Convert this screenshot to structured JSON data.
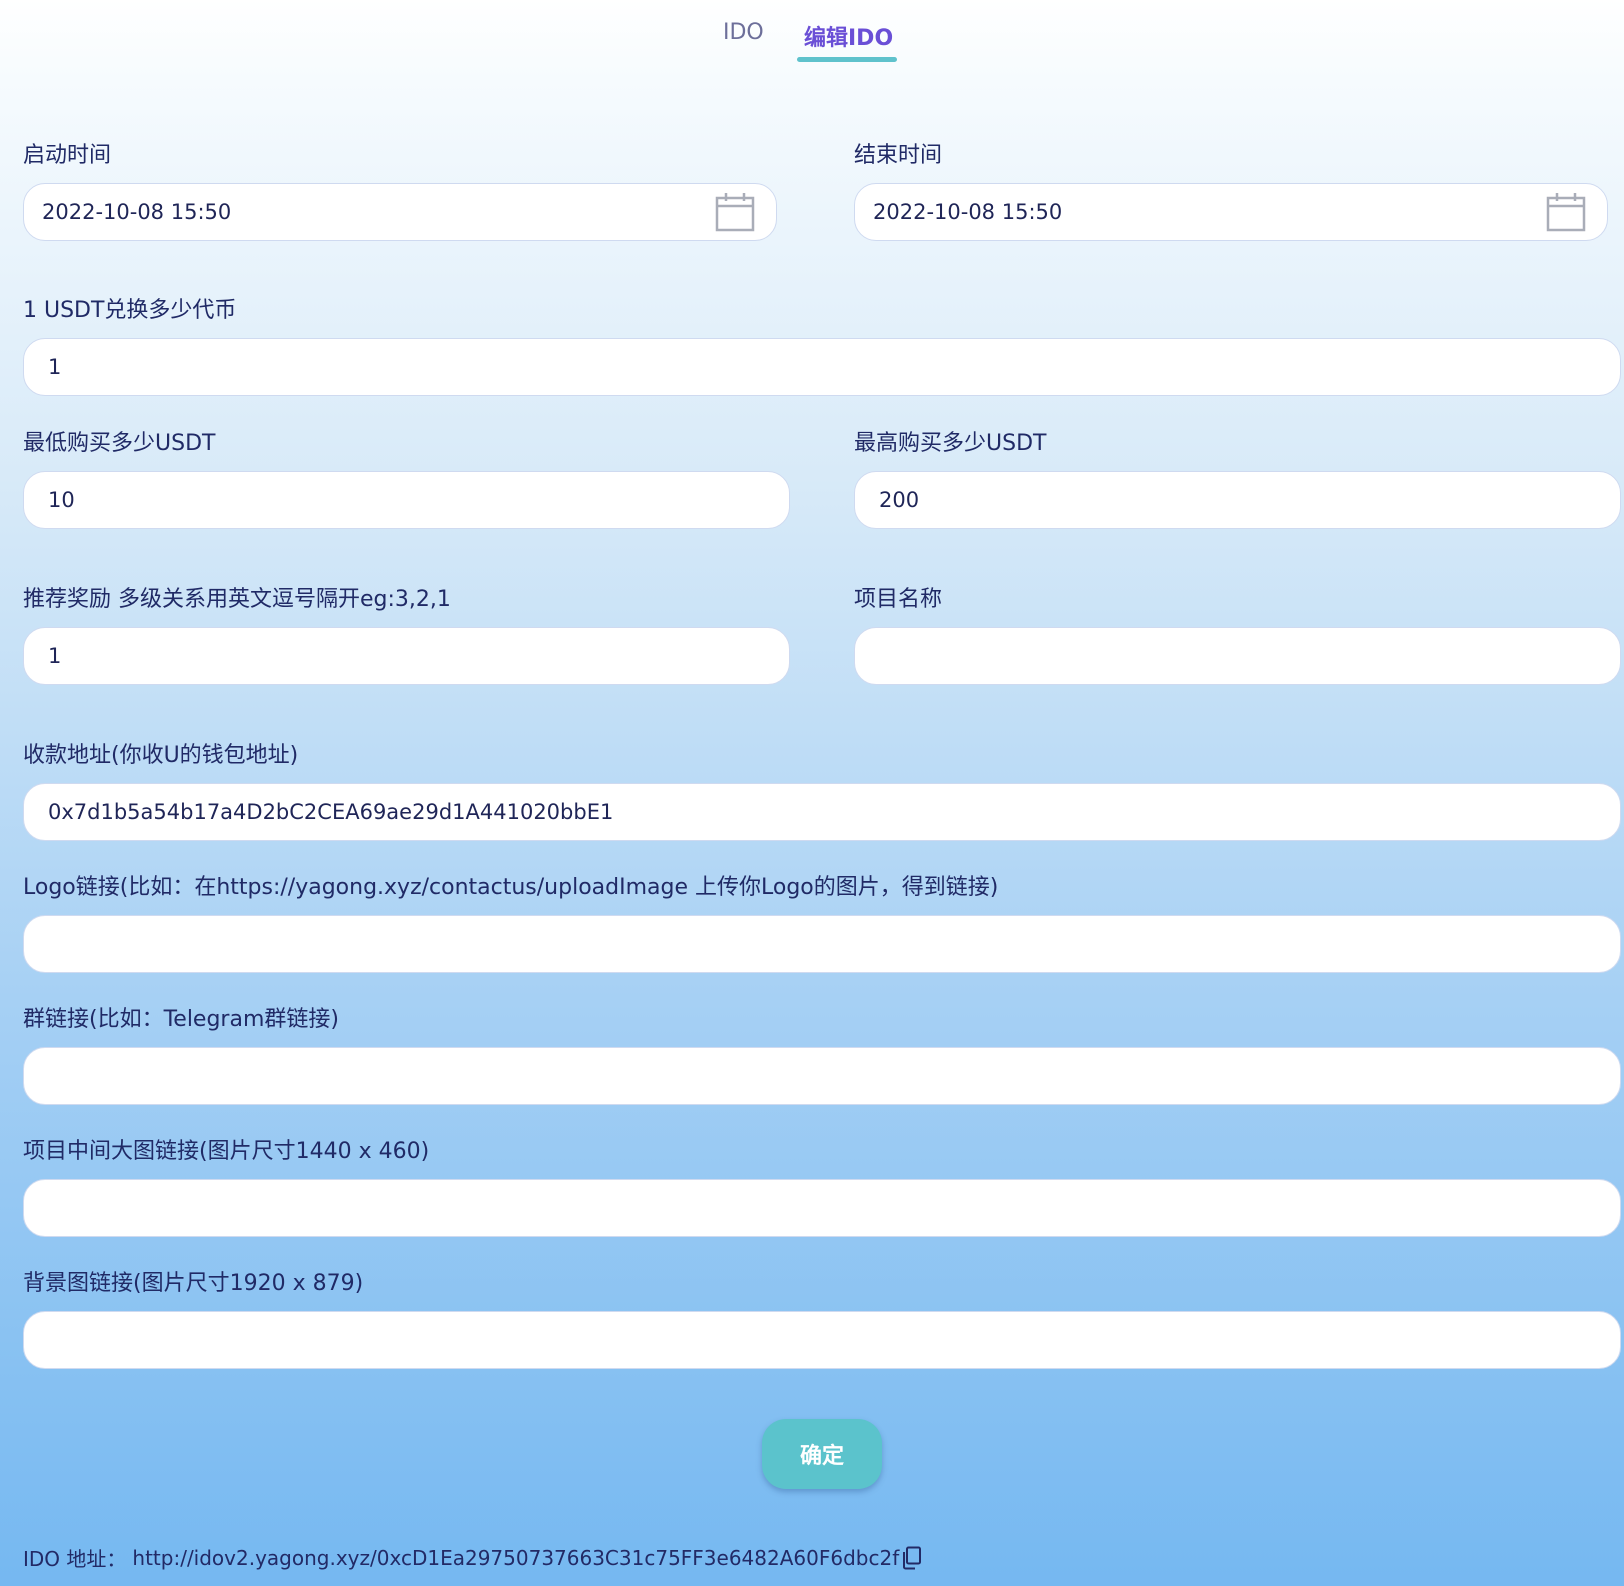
{
  "tabs": {
    "items": [
      {
        "label": "IDO"
      },
      {
        "label": "编辑IDO"
      }
    ],
    "active": "编辑IDO"
  },
  "form": {
    "start_time": {
      "label": "启动时间",
      "value": "2022-10-08 15:50"
    },
    "end_time": {
      "label": "结束时间",
      "value": "2022-10-08 15:50"
    },
    "rate": {
      "label": "1 USDT兑换多少代币",
      "value": "1"
    },
    "min_buy": {
      "label": "最低购买多少USDT",
      "value": "10"
    },
    "max_buy": {
      "label": "最高购买多少USDT",
      "value": "200"
    },
    "referral": {
      "label": "推荐奖励 多级关系用英文逗号隔开eg:3,2,1",
      "value": "1"
    },
    "project_name": {
      "label": "项目名称",
      "value": ""
    },
    "receive_address": {
      "label": "收款地址(你收U的钱包地址)",
      "value": "0x7d1b5a54b17a4D2bC2CEA69ae29d1A441020bbE1"
    },
    "logo_link": {
      "label": "Logo链接(比如：在https://yagong.xyz/contactus/uploadImage 上传你Logo的图片，得到链接)",
      "value": ""
    },
    "group_link": {
      "label": "群链接(比如：Telegram群链接)",
      "value": ""
    },
    "banner_link": {
      "label": "项目中间大图链接(图片尺寸1440 x 460)",
      "value": ""
    },
    "background_link": {
      "label": "背景图链接(图片尺寸1920 x 879)",
      "value": ""
    },
    "submit_label": "确定"
  },
  "footer": {
    "ido_address_label": "IDO 地址：",
    "ido_address_value": "http://idov2.yagong.xyz/0xcD1Ea29750737663C31c75FF3e6482A60F6dbc2f"
  },
  "icons": {
    "date_picker": "calendar-icon",
    "copy": "copy-icon"
  },
  "colors": {
    "accent": "#6a4fd6",
    "tab_underline": "#5fc2cc",
    "button": "#5bc3cc",
    "text": "#202a66",
    "gradient_top": "#ffffff",
    "gradient_bottom": "#75b8f1"
  }
}
